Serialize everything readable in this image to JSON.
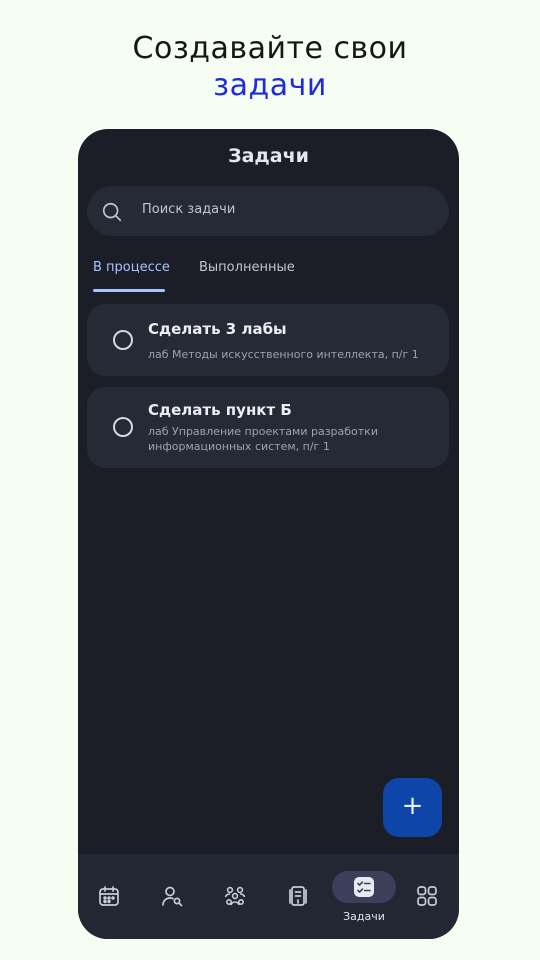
{
  "promo": {
    "line1": "Создавайте свои",
    "line2": "задачи"
  },
  "screen": {
    "title": "Задачи",
    "search_placeholder": "Поиск задачи",
    "tabs": [
      {
        "label": "В процессе",
        "active": true
      },
      {
        "label": "Выполненные",
        "active": false
      }
    ],
    "tasks": [
      {
        "title": "Сделать 3 лабы",
        "subtitle": "лаб Методы искусственного интеллекта, п/г 1",
        "completed": false
      },
      {
        "title": "Сделать пункт Б",
        "subtitle": "лаб Управление проектами разработки информационных систем, п/г 1",
        "completed": false
      }
    ],
    "fab_symbol": "+"
  },
  "nav": {
    "items": [
      {
        "icon": "calendar-icon"
      },
      {
        "icon": "person-search-icon"
      },
      {
        "icon": "groups-icon"
      },
      {
        "icon": "document-icon"
      },
      {
        "icon": "tasks-checklist-icon",
        "label": "Задачи",
        "active": true
      },
      {
        "icon": "apps-grid-icon"
      }
    ]
  },
  "colors": {
    "background": "#f6fdf2",
    "accent_text": "#1f2bd8",
    "phone_bg": "#1b1e27",
    "card_bg": "#262a35",
    "tab_active": "#a9c3ff",
    "fab": "#0e45a8"
  }
}
